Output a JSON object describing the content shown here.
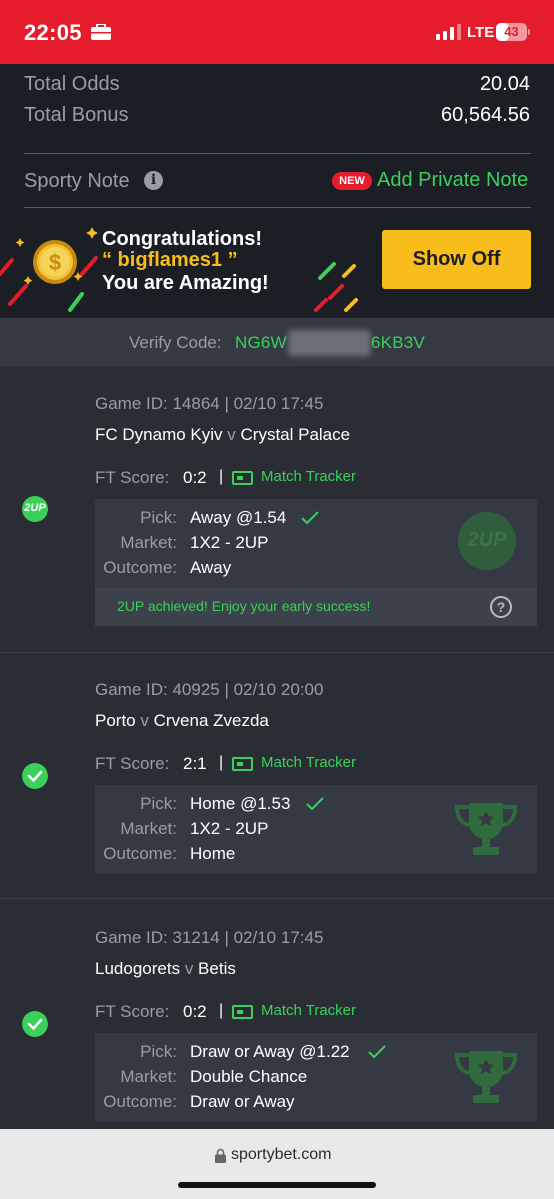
{
  "status_bar": {
    "time": "22:05",
    "network": "LTE",
    "battery": "43",
    "battery_level": 0.43,
    "icons": [
      "briefcase-icon",
      "signal-icon",
      "battery-icon"
    ]
  },
  "summary": {
    "total_odds_label": "Total Odds",
    "total_odds_value": "20.04",
    "total_bonus_label": "Total Bonus",
    "total_bonus_value": "60,564.56",
    "note_label": "Sporty Note",
    "new_badge": "NEW",
    "add_note": "Add Private Note"
  },
  "banner": {
    "line1": "Congratulations!",
    "username": "“ bigflames1 ”",
    "line3": "You are Amazing!",
    "button": "Show Off"
  },
  "verify": {
    "label": "Verify Code:",
    "code_start": "NG6W",
    "code_end": "6KB3V"
  },
  "games": [
    {
      "game_id": "Game ID: 14864 | 02/10 17:45",
      "home": "FC Dynamo Kyiv",
      "vs": "v",
      "away": "Crystal Palace",
      "score_label": "FT Score:",
      "score": "0:2",
      "separator": "|",
      "tracker": "Match Tracker",
      "pick_label": "Pick:",
      "pick": "Away @1.54",
      "market_label": "Market:",
      "market": "1X2 - 2UP",
      "outcome_label": "Outcome:",
      "outcome": "Away",
      "badge": "2UP",
      "footer_msg": "2UP achieved! Enjoy your early success!",
      "help": "?"
    },
    {
      "game_id": "Game ID: 40925 | 02/10 20:00",
      "home": "Porto",
      "vs": "v",
      "away": "Crvena Zvezda",
      "score_label": "FT Score:",
      "score": "2:1",
      "separator": "|",
      "tracker": "Match Tracker",
      "pick_label": "Pick:",
      "pick": "Home @1.53",
      "market_label": "Market:",
      "market": "1X2 - 2UP",
      "outcome_label": "Outcome:",
      "outcome": "Home"
    },
    {
      "game_id": "Game ID: 31214 | 02/10 17:45",
      "home": "Ludogorets",
      "vs": "v",
      "away": "Betis",
      "score_label": "FT Score:",
      "score": "0:2",
      "separator": "|",
      "tracker": "Match Tracker",
      "pick_label": "Pick:",
      "pick": "Draw or Away @1.22",
      "market_label": "Market:",
      "market": "Double Chance",
      "outcome_label": "Outcome:",
      "outcome": "Draw or Away"
    }
  ],
  "browser": {
    "url": "sportybet.com"
  },
  "colors": {
    "accent_green": "#3ad15b",
    "brand_red": "#e41c2c",
    "button_yellow": "#f8bd1b"
  }
}
